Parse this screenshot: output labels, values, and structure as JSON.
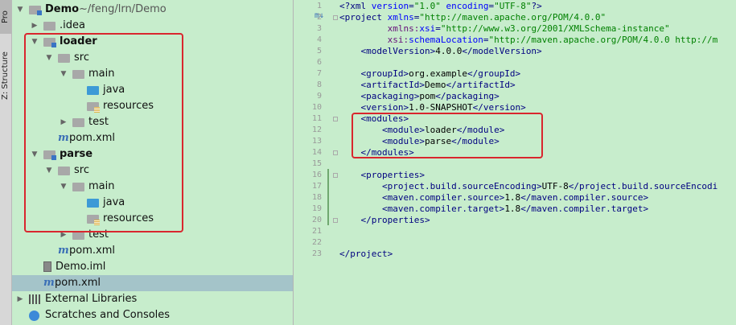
{
  "toolwindow_tabs": {
    "project": "Pro",
    "structure": "Z: Structure"
  },
  "tree": [
    {
      "id": "demo",
      "label": "Demo",
      "path": "~/feng/lrn/Demo",
      "indent": 0,
      "arrow": "down",
      "icon": "folder-module",
      "bold": true
    },
    {
      "id": "idea",
      "label": ".idea",
      "indent": 1,
      "arrow": "right",
      "icon": "folder"
    },
    {
      "id": "loader",
      "label": "loader",
      "indent": 1,
      "arrow": "down",
      "icon": "folder-module",
      "bold": true
    },
    {
      "id": "loader-src",
      "label": "src",
      "indent": 2,
      "arrow": "down",
      "icon": "folder"
    },
    {
      "id": "loader-main",
      "label": "main",
      "indent": 3,
      "arrow": "down",
      "icon": "folder"
    },
    {
      "id": "loader-java",
      "label": "java",
      "indent": 4,
      "arrow": "",
      "icon": "folder-blue"
    },
    {
      "id": "loader-resources",
      "label": "resources",
      "indent": 4,
      "arrow": "",
      "icon": "folder-resources"
    },
    {
      "id": "loader-test",
      "label": "test",
      "indent": 3,
      "arrow": "right",
      "icon": "folder"
    },
    {
      "id": "loader-pom",
      "label": "pom.xml",
      "indent": 2,
      "arrow": "",
      "icon": "maven"
    },
    {
      "id": "parse",
      "label": "parse",
      "indent": 1,
      "arrow": "down",
      "icon": "folder-module",
      "bold": true
    },
    {
      "id": "parse-src",
      "label": "src",
      "indent": 2,
      "arrow": "down",
      "icon": "folder"
    },
    {
      "id": "parse-main",
      "label": "main",
      "indent": 3,
      "arrow": "down",
      "icon": "folder"
    },
    {
      "id": "parse-java",
      "label": "java",
      "indent": 4,
      "arrow": "",
      "icon": "folder-blue"
    },
    {
      "id": "parse-resources",
      "label": "resources",
      "indent": 4,
      "arrow": "",
      "icon": "folder-resources"
    },
    {
      "id": "parse-test",
      "label": "test",
      "indent": 3,
      "arrow": "right",
      "icon": "folder"
    },
    {
      "id": "parse-pom",
      "label": "pom.xml",
      "indent": 2,
      "arrow": "",
      "icon": "maven"
    },
    {
      "id": "demo-iml",
      "label": "Demo.iml",
      "indent": 1,
      "arrow": "",
      "icon": "iml"
    },
    {
      "id": "root-pom",
      "label": "pom.xml",
      "indent": 1,
      "arrow": "",
      "icon": "maven",
      "selected": true
    },
    {
      "id": "ext-libs",
      "label": "External Libraries",
      "indent": 0,
      "arrow": "right",
      "icon": "libraries"
    },
    {
      "id": "scratches",
      "label": "Scratches and Consoles",
      "indent": 0,
      "arrow": "",
      "icon": "scratches"
    }
  ],
  "gutter_marker": "m↓",
  "code_lines": [
    [
      [
        "tag",
        "<?xml "
      ],
      [
        "attr",
        "version"
      ],
      [
        "tag",
        "="
      ],
      [
        "val",
        "\"1.0\""
      ],
      [
        "tag",
        " "
      ],
      [
        "attr",
        "encoding"
      ],
      [
        "tag",
        "="
      ],
      [
        "val",
        "\"UTF-8\""
      ],
      [
        "tag",
        "?>"
      ]
    ],
    [
      [
        "tag",
        "<project "
      ],
      [
        "attr",
        "xmlns"
      ],
      [
        "tag",
        "="
      ],
      [
        "val",
        "\"http://maven.apache.org/POM/4.0.0\""
      ]
    ],
    [
      [
        "tag",
        "         "
      ],
      [
        "ns",
        "xmlns:"
      ],
      [
        "attr",
        "xsi"
      ],
      [
        "tag",
        "="
      ],
      [
        "val",
        "\"http://www.w3.org/2001/XMLSchema-instance\""
      ]
    ],
    [
      [
        "tag",
        "         "
      ],
      [
        "ns",
        "xsi:"
      ],
      [
        "attr",
        "schemaLocation"
      ],
      [
        "tag",
        "="
      ],
      [
        "val",
        "\"http://maven.apache.org/POM/4.0.0 http://m"
      ]
    ],
    [
      [
        "tag",
        "    <modelVersion>"
      ],
      [
        "txt",
        "4.0.0"
      ],
      [
        "tag",
        "</modelVersion>"
      ]
    ],
    [],
    [
      [
        "tag",
        "    <groupId>"
      ],
      [
        "txt",
        "org.example"
      ],
      [
        "tag",
        "</groupId>"
      ]
    ],
    [
      [
        "tag",
        "    <artifactId>"
      ],
      [
        "txt",
        "Demo"
      ],
      [
        "tag",
        "</artifactId>"
      ]
    ],
    [
      [
        "tag",
        "    <packaging>"
      ],
      [
        "txt",
        "pom"
      ],
      [
        "tag",
        "</packaging>"
      ]
    ],
    [
      [
        "tag",
        "    <version>"
      ],
      [
        "txt",
        "1.0-SNAPSHOT"
      ],
      [
        "tag",
        "</version>"
      ]
    ],
    [
      [
        "tag",
        "    <modules>"
      ]
    ],
    [
      [
        "tag",
        "        <module>"
      ],
      [
        "txt",
        "loader"
      ],
      [
        "tag",
        "</module>"
      ]
    ],
    [
      [
        "tag",
        "        <module>"
      ],
      [
        "txt",
        "parse"
      ],
      [
        "tag",
        "</module>"
      ]
    ],
    [
      [
        "tag",
        "    </modules>"
      ]
    ],
    [],
    [
      [
        "tag",
        "    <properties>"
      ]
    ],
    [
      [
        "tag",
        "        <project.build.sourceEncoding>"
      ],
      [
        "txt",
        "UTF-8"
      ],
      [
        "tag",
        "</project.build.sourceEncodi"
      ]
    ],
    [
      [
        "tag",
        "        <maven.compiler.source>"
      ],
      [
        "txt",
        "1.8"
      ],
      [
        "tag",
        "</maven.compiler.source>"
      ]
    ],
    [
      [
        "tag",
        "        <maven.compiler.target>"
      ],
      [
        "txt",
        "1.8"
      ],
      [
        "tag",
        "</maven.compiler.target>"
      ]
    ],
    [
      [
        "tag",
        "    </properties>"
      ]
    ],
    [],
    [],
    [
      [
        "tag",
        "</project>"
      ]
    ]
  ],
  "colors": {
    "background": "#c7edcc",
    "selection": "#a4c4c9",
    "highlight_box": "#d9262e"
  }
}
